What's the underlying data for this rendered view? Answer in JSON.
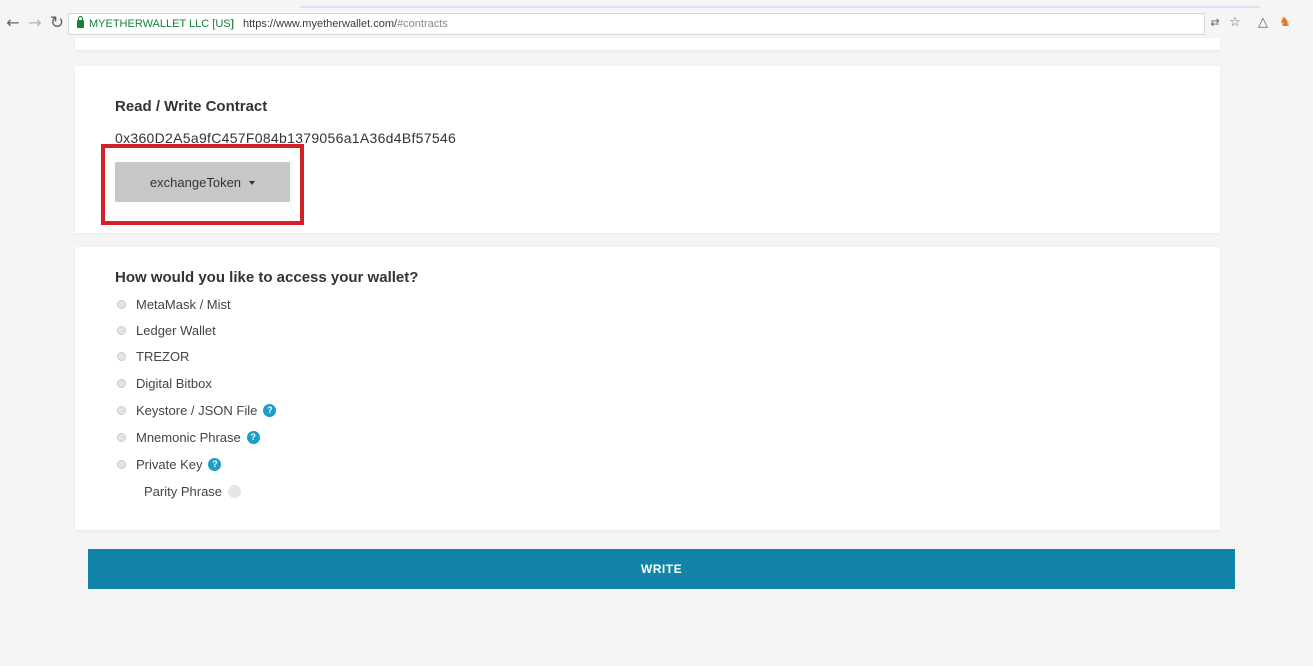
{
  "browser": {
    "site_identity": "MYETHERWALLET LLC [US]",
    "url_base": "https://www.myetherwallet.com/",
    "url_fragment": "#contracts"
  },
  "contract": {
    "title": "Read / Write Contract",
    "address": "0x360D2A5a9fC457F084b1379056a1A36d4Bf57546",
    "selected_function": "exchangeToken"
  },
  "wallet": {
    "heading": "How would you like to access your wallet?",
    "options": [
      {
        "label": "MetaMask / Mist"
      },
      {
        "label": "Ledger Wallet"
      },
      {
        "label": "TREZOR"
      },
      {
        "label": "Digital Bitbox"
      },
      {
        "label": "Keystore / JSON File"
      },
      {
        "label": "Mnemonic Phrase"
      },
      {
        "label": "Private Key"
      },
      {
        "label": "Parity Phrase"
      }
    ]
  },
  "actions": {
    "write_label": "WRITE"
  },
  "colors": {
    "accent": "#1184a8",
    "help_icon": "#1d9ec6",
    "highlight": "#d42027",
    "secure_green": "#188038"
  }
}
